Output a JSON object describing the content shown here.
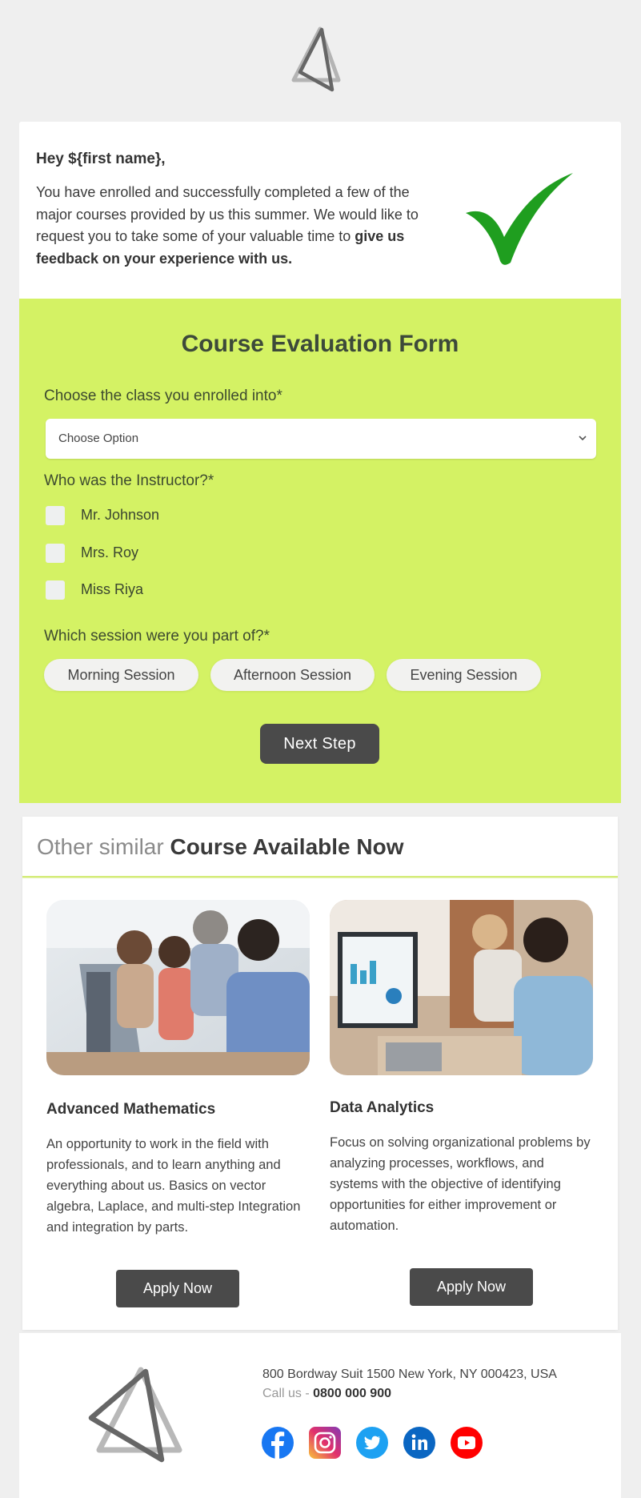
{
  "brand": {
    "logo_icon": "triangle-logo-icon"
  },
  "intro": {
    "greeting": "Hey ${first name},",
    "text_regular": "You have enrolled and successfully completed a few of the major courses provided by us this summer. We would like to request you to take some of your valuable time to ",
    "text_bold": "give us feedback on your experience with us.",
    "icon": "checkmark-icon"
  },
  "form": {
    "title": "Course Evaluation Form",
    "q1": {
      "label": "Choose the class you enrolled into*",
      "select_value": "Choose Option"
    },
    "q2": {
      "label": "Who was the Instructor?*",
      "options": [
        "Mr. Johnson",
        "Mrs. Roy",
        "Miss Riya"
      ]
    },
    "q3": {
      "label": "Which session were you part of?*",
      "options": [
        "Morning Session",
        "Afternoon Session",
        "Evening Session"
      ]
    },
    "next_button": "Next Step"
  },
  "courses": {
    "heading_light": "Other similar ",
    "heading_bold": "Course Available Now",
    "items": [
      {
        "title": "Advanced Mathematics",
        "description": "An opportunity to work in the field with professionals, and to learn anything and everything about us. Basics on vector algebra, Laplace, and multi-step Integration and integration by parts.",
        "button": "Apply Now",
        "image": "students-at-computer-photo"
      },
      {
        "title": "Data Analytics",
        "description": "Focus on solving organizational problems by analyzing processes, workflows, and systems with the objective of identifying opportunities for either improvement or automation.",
        "button": "Apply Now",
        "image": "office-analytics-photo"
      }
    ]
  },
  "footer": {
    "address": "800 Bordway Suit 1500 New York, NY 000423, USA",
    "call_label": "Call us - ",
    "phone": "0800 000 900",
    "social": [
      {
        "name": "facebook",
        "color": "#1877f2"
      },
      {
        "name": "instagram",
        "color": "#c13584"
      },
      {
        "name": "twitter",
        "color": "#1da1f2"
      },
      {
        "name": "linkedin",
        "color": "#0a66c2"
      },
      {
        "name": "youtube",
        "color": "#ff0000"
      }
    ]
  },
  "colors": {
    "form_background": "#d4f264",
    "button_dark": "#4a4a4a",
    "check_green": "#1f9e1f",
    "page_background": "#efefef"
  }
}
